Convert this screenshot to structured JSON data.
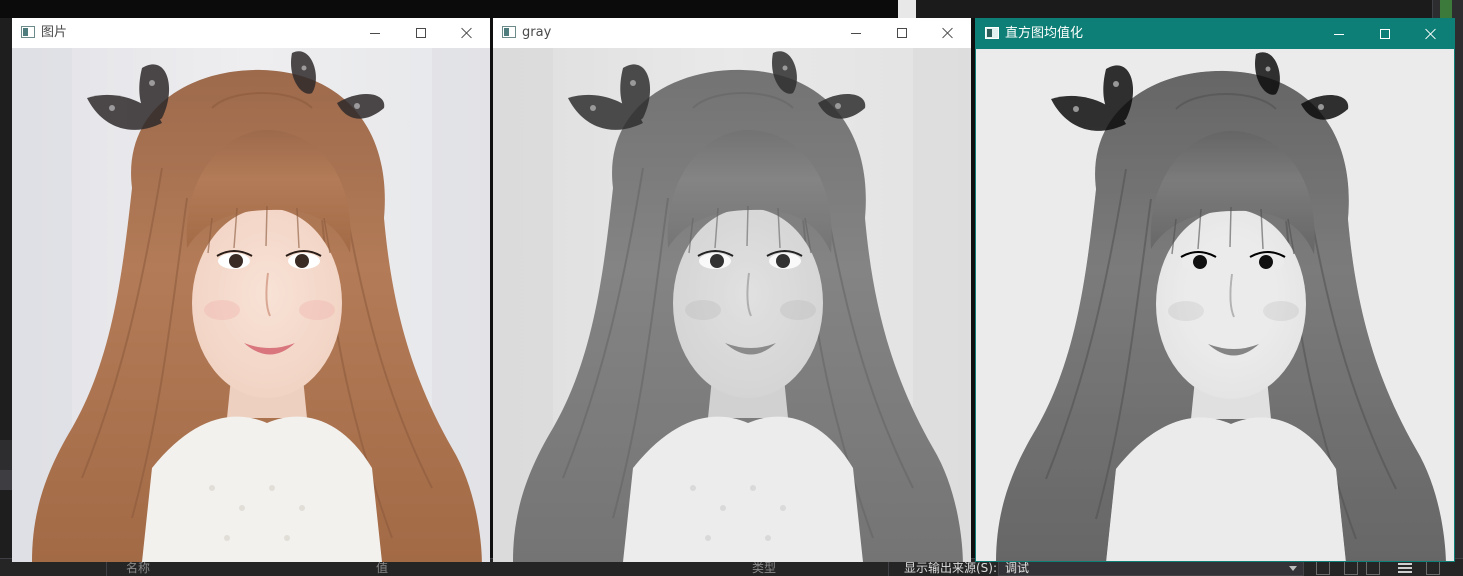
{
  "windows": [
    {
      "id": "original",
      "title": "图片",
      "active": false,
      "filter": "color"
    },
    {
      "id": "gray",
      "title": "gray",
      "active": false,
      "filter": "grayscale"
    },
    {
      "id": "equalized",
      "title": "直方图均值化",
      "active": true,
      "filter": "equalized"
    }
  ],
  "window_controls": {
    "minimize": "minimize-icon",
    "maximize": "maximize-icon",
    "close": "close-icon"
  },
  "bottom_panel": {
    "columns": [
      "名称",
      "值",
      "类型"
    ],
    "output_label": "显示输出来源(S):",
    "output_source": "调试"
  },
  "colors": {
    "active_titlebar": "#0e7f76",
    "inactive_titlebar": "#ffffff",
    "ide_background": "#1e1e1e",
    "hair": "#b37b57",
    "skin": "#f1d2c2",
    "background_wall": "#eeeef0"
  }
}
